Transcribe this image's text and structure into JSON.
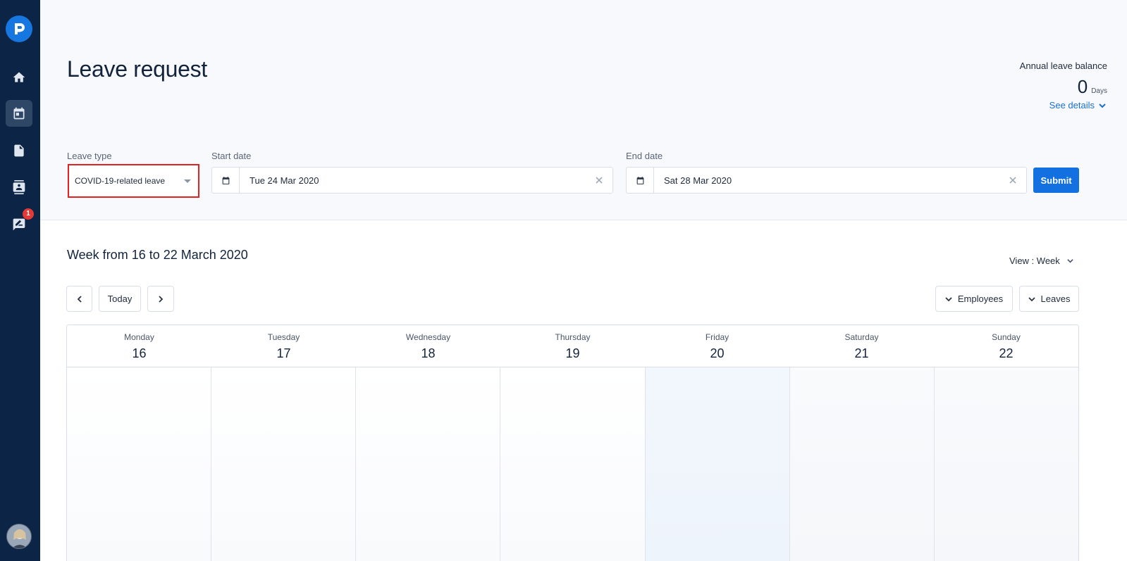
{
  "sidebar": {
    "logo_letter": "P",
    "notification_count": "1"
  },
  "header": {
    "title": "Leave request",
    "balance_label": "Annual leave balance",
    "balance_value": "0",
    "balance_unit": "Days",
    "see_details": "See details"
  },
  "form": {
    "leave_type_label": "Leave type",
    "leave_type_value": "COVID-19-related leave",
    "start_date_label": "Start date",
    "start_date_value": "Tue 24 Mar 2020",
    "end_date_label": "End date",
    "end_date_value": "Sat 28 Mar 2020",
    "submit_label": "Submit"
  },
  "calendar": {
    "week_title": "Week from 16 to 22 March 2020",
    "view_label": "View : Week",
    "today_label": "Today",
    "employees_label": "Employees",
    "leaves_label": "Leaves",
    "days": [
      {
        "name": "Monday",
        "num": "16"
      },
      {
        "name": "Tuesday",
        "num": "17"
      },
      {
        "name": "Wednesday",
        "num": "18"
      },
      {
        "name": "Thursday",
        "num": "19"
      },
      {
        "name": "Friday",
        "num": "20"
      },
      {
        "name": "Saturday",
        "num": "21"
      },
      {
        "name": "Sunday",
        "num": "22"
      }
    ]
  },
  "colors": {
    "sidebar_bg": "#0c2445",
    "accent": "#1270e0",
    "highlight_border": "#e52020"
  }
}
